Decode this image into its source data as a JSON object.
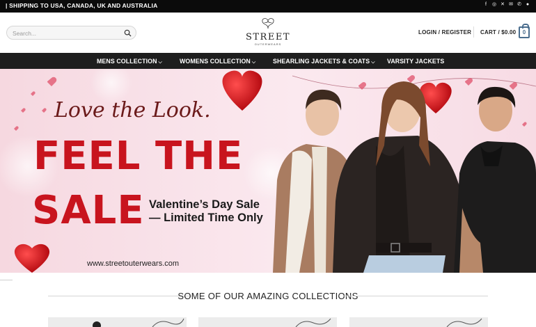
{
  "topbar": {
    "shipping_text": "| SHIPPING TO USA, CANADA, UK AND AUSTRALIA",
    "socials": [
      "facebook-icon",
      "instagram-icon",
      "x-icon",
      "email-icon",
      "phone-icon",
      "pinterest-icon"
    ]
  },
  "header": {
    "search_placeholder": "Search...",
    "logo_text": "STREET",
    "logo_sub": "OUTERWEARS",
    "login_label": "LOGIN / REGISTER",
    "cart_label": "CART / $0.00",
    "cart_count": "0"
  },
  "nav": {
    "items": [
      {
        "label": "MENS COLLECTION",
        "has_dropdown": true
      },
      {
        "label": "WOMENS COLLECTION",
        "has_dropdown": true
      },
      {
        "label": "SHEARLING JACKETS & COATS",
        "has_dropdown": true
      },
      {
        "label": "VARSITY JACKETS",
        "has_dropdown": false
      }
    ]
  },
  "hero": {
    "headline_script": "Love the Look.",
    "headline_line1": "FEEL THE",
    "headline_line2": "SALE",
    "subtext": "Valentine’s Day Sale — Limited Time Only",
    "url": "www.streetouterwears.com"
  },
  "collections": {
    "title": "SOME OF OUR AMAZING COLLECTIONS"
  },
  "colors": {
    "topbar_bg": "#0b0b0b",
    "nav_bg": "#1e1e1e",
    "sale_red": "#c8141e",
    "cart_blue": "#4b6e8e"
  }
}
